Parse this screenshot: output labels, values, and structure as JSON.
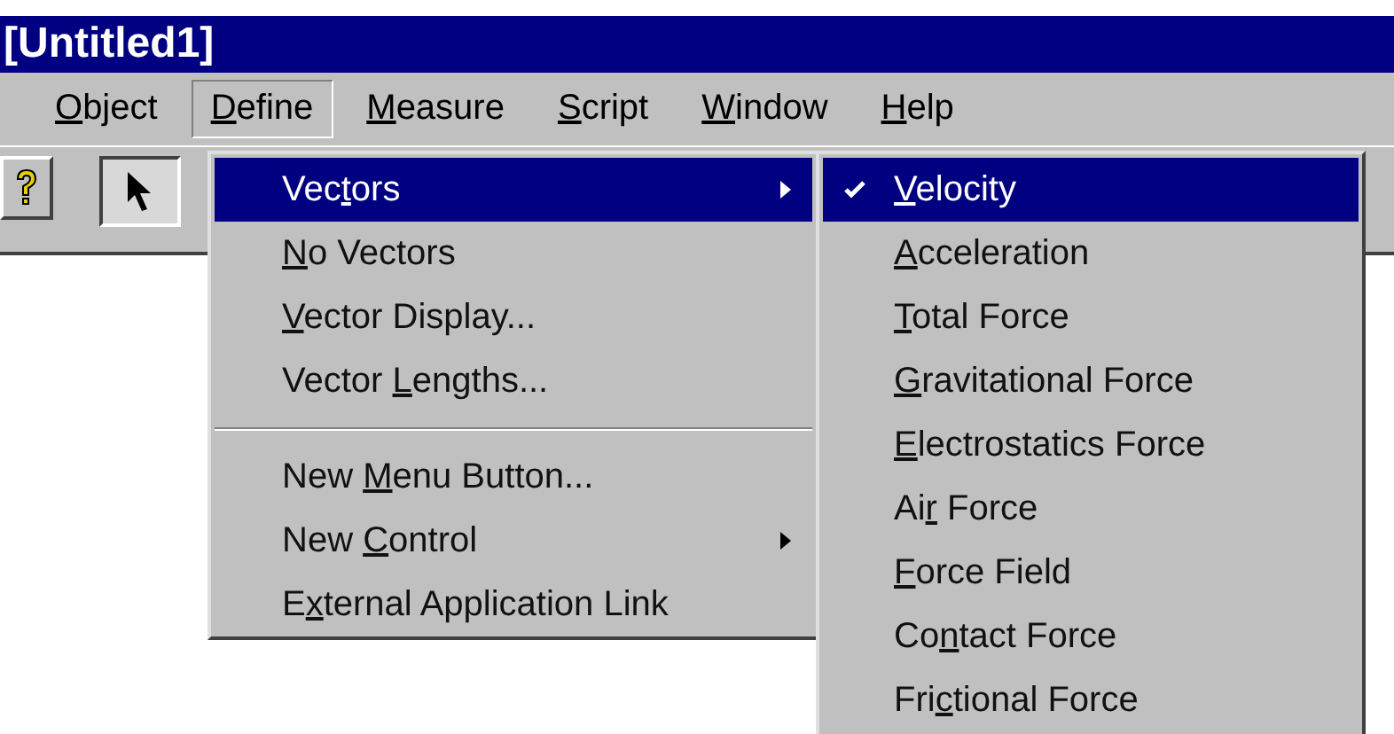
{
  "window": {
    "title": "[Untitled1]"
  },
  "menu_bar": [
    {
      "key": "O",
      "after": "bject",
      "selected": false
    },
    {
      "key": "D",
      "after": "efine",
      "selected": true
    },
    {
      "key": "M",
      "after": "easure",
      "selected": false
    },
    {
      "key": "S",
      "after": "cript",
      "selected": false
    },
    {
      "key": "W",
      "after": "indow",
      "selected": false
    },
    {
      "key": "H",
      "after": "elp",
      "selected": false
    }
  ],
  "define_menu": [
    {
      "kind": "item",
      "before": "Vec",
      "key": "t",
      "after": "ors",
      "submenu": true,
      "selected": true
    },
    {
      "kind": "item",
      "key": "N",
      "after": "o Vectors",
      "submenu": false,
      "selected": false
    },
    {
      "kind": "item",
      "key": "V",
      "after": "ector Display...",
      "submenu": false,
      "selected": false
    },
    {
      "kind": "item",
      "before": "Vector ",
      "key": "L",
      "after": "engths...",
      "submenu": false,
      "selected": false
    },
    {
      "kind": "separator"
    },
    {
      "kind": "item",
      "before": "New ",
      "key": "M",
      "after": "enu Button...",
      "submenu": false,
      "selected": false
    },
    {
      "kind": "item",
      "before": "New ",
      "key": "C",
      "after": "ontrol",
      "submenu": true,
      "selected": false
    },
    {
      "kind": "item",
      "before": "E",
      "key": "x",
      "after": "ternal Application Link",
      "submenu": false,
      "selected": false
    }
  ],
  "vectors_submenu": [
    {
      "key": "V",
      "after": "elocity",
      "checked": true,
      "selected": true
    },
    {
      "key": "A",
      "after": "cceleration",
      "checked": false,
      "selected": false
    },
    {
      "key": "T",
      "after": "otal Force",
      "checked": false,
      "selected": false
    },
    {
      "key": "G",
      "after": "ravitational Force",
      "checked": false,
      "selected": false
    },
    {
      "key": "E",
      "after": "lectrostatics Force",
      "checked": false,
      "selected": false
    },
    {
      "before": "Ai",
      "key": "r",
      "after": " Force",
      "checked": false,
      "selected": false
    },
    {
      "key": "F",
      "after": "orce Field",
      "checked": false,
      "selected": false
    },
    {
      "before": "Co",
      "key": "n",
      "after": "tact Force",
      "checked": false,
      "selected": false
    },
    {
      "before": "Fri",
      "key": "c",
      "after": "tional Force",
      "checked": false,
      "selected": false
    }
  ]
}
